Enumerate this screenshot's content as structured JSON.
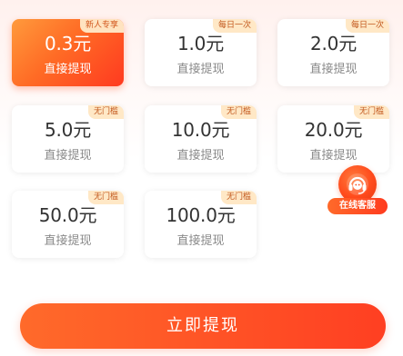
{
  "colors": {
    "accent": "#ff4a20",
    "tag_bg": "#ffe8c6",
    "tag_text": "#c2581d"
  },
  "options": [
    {
      "amount": "0.3元",
      "sub": "直接提现",
      "tag": "新人专享",
      "selected": true
    },
    {
      "amount": "1.0元",
      "sub": "直接提现",
      "tag": "每日一次",
      "selected": false
    },
    {
      "amount": "2.0元",
      "sub": "直接提现",
      "tag": "每日一次",
      "selected": false
    },
    {
      "amount": "5.0元",
      "sub": "直接提现",
      "tag": "无门槛",
      "selected": false
    },
    {
      "amount": "10.0元",
      "sub": "直接提现",
      "tag": "无门槛",
      "selected": false
    },
    {
      "amount": "20.0元",
      "sub": "直接提现",
      "tag": "无门槛",
      "selected": false
    },
    {
      "amount": "50.0元",
      "sub": "直接提现",
      "tag": "无门槛",
      "selected": false
    },
    {
      "amount": "100.0元",
      "sub": "直接提现",
      "tag": "无门槛",
      "selected": false
    }
  ],
  "customer_service": {
    "label": "在线客服",
    "icon": "headset-icon"
  },
  "submit": {
    "label": "立即提现"
  }
}
